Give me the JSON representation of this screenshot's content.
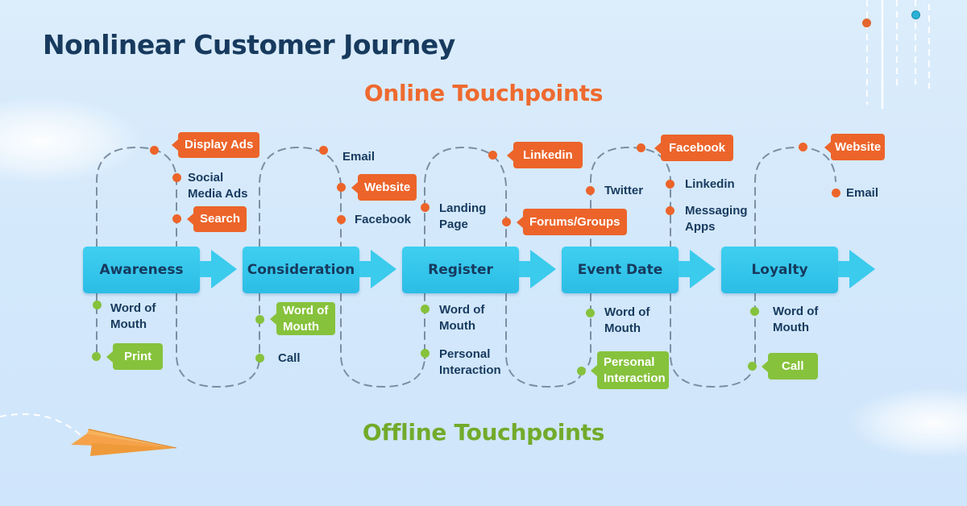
{
  "title": "Nonlinear Customer Journey",
  "online_title": "Online Touchpoints",
  "offline_title": "Offline Touchpoints",
  "colors": {
    "title": "#173a5e",
    "online": "#ec642a",
    "offline": "#86c23c",
    "stage": "#2cbde6",
    "path": "#7b8ea3"
  },
  "stages": [
    {
      "label": "Awareness",
      "online": [
        {
          "text": "Display Ads",
          "style": "tag"
        },
        {
          "text": "Social Media Ads",
          "style": "plain"
        },
        {
          "text": "Search",
          "style": "tag"
        }
      ],
      "offline": [
        {
          "text": "Word of Mouth",
          "style": "plain"
        },
        {
          "text": "Print",
          "style": "tag"
        }
      ]
    },
    {
      "label": "Consideration",
      "online": [
        {
          "text": "Email",
          "style": "plain"
        },
        {
          "text": "Website",
          "style": "tag"
        },
        {
          "text": "Facebook",
          "style": "plain"
        }
      ],
      "offline": [
        {
          "text": "Word of Mouth",
          "style": "tag"
        },
        {
          "text": "Call",
          "style": "plain"
        }
      ]
    },
    {
      "label": "Register",
      "online": [
        {
          "text": "Linkedin",
          "style": "tag"
        },
        {
          "text": "Landing Page",
          "style": "plain"
        },
        {
          "text": "Forums/Groups",
          "style": "tag"
        }
      ],
      "offline": [
        {
          "text": "Word of Mouth",
          "style": "plain"
        },
        {
          "text": "Personal Interaction",
          "style": "plain"
        }
      ]
    },
    {
      "label": "Event Date",
      "online": [
        {
          "text": "Facebook",
          "style": "tag"
        },
        {
          "text": "Twitter",
          "style": "plain"
        },
        {
          "text": "Linkedin",
          "style": "plain"
        },
        {
          "text": "Messaging Apps",
          "style": "plain"
        }
      ],
      "offline": [
        {
          "text": "Word of Mouth",
          "style": "plain"
        },
        {
          "text": "Personal Interaction",
          "style": "tag"
        }
      ]
    },
    {
      "label": "Loyalty",
      "online": [
        {
          "text": "Website",
          "style": "tag"
        },
        {
          "text": "Email",
          "style": "plain"
        }
      ],
      "offline": [
        {
          "text": "Word of Mouth",
          "style": "plain"
        },
        {
          "text": "Call",
          "style": "tag"
        }
      ]
    }
  ]
}
